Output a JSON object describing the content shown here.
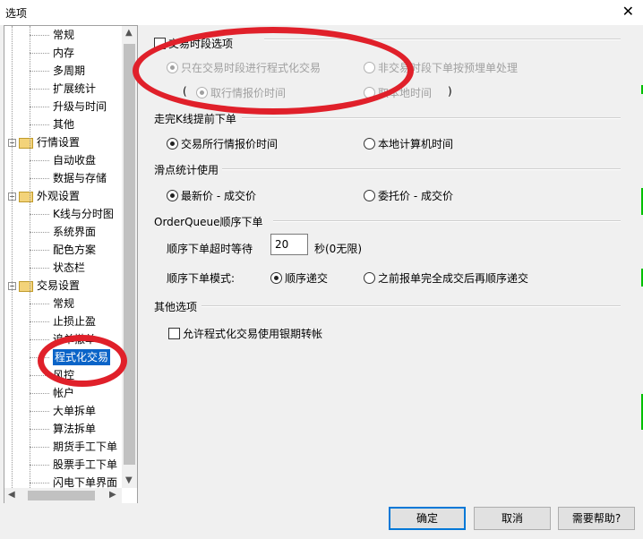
{
  "window": {
    "title": "选项",
    "close_glyph": "✕"
  },
  "tree": {
    "items": [
      {
        "label": "常规"
      },
      {
        "label": "内存"
      },
      {
        "label": "多周期"
      },
      {
        "label": "扩展统计"
      },
      {
        "label": "升级与时间"
      },
      {
        "label": "其他"
      },
      {
        "label": "行情设置",
        "folder": true
      },
      {
        "label": "自动收盘"
      },
      {
        "label": "数据与存储"
      },
      {
        "label": "外观设置",
        "folder": true
      },
      {
        "label": "K线与分时图"
      },
      {
        "label": "系统界面"
      },
      {
        "label": "配色方案"
      },
      {
        "label": "状态栏"
      },
      {
        "label": "交易设置",
        "folder": true
      },
      {
        "label": "常规"
      },
      {
        "label": "止损止盈"
      },
      {
        "label": "追单撤单"
      },
      {
        "label": "程式化交易",
        "selected": true
      },
      {
        "label": "风控"
      },
      {
        "label": "帐户"
      },
      {
        "label": "大单拆单"
      },
      {
        "label": "算法拆单"
      },
      {
        "label": "期货手工下单"
      },
      {
        "label": "股票手工下单"
      },
      {
        "label": "闪电下单界面"
      }
    ]
  },
  "trading_period": {
    "checkbox_label": "交易时段选项",
    "checked": false,
    "opt_only_in_session": "只在交易时段进行程式化交易",
    "opt_non_session": "非交易时段下单按预埋单处理",
    "paren_open": "(",
    "opt_quote_time": "取行情报价时间",
    "opt_local_time": "取本地时间",
    "paren_close": ")"
  },
  "kline_early": {
    "heading": "走完K线提前下单",
    "opt_exchange": "交易所行情报价时间",
    "opt_local": "本地计算机时间",
    "selected": "opt_exchange"
  },
  "slippage": {
    "heading": "滑点统计使用",
    "opt_latest": "最新价 - 成交价",
    "opt_order": "委托价 - 成交价",
    "selected": "opt_latest"
  },
  "order_queue": {
    "heading": "OrderQueue顺序下单",
    "timeout_label": "顺序下单超时等待",
    "timeout_value": "20",
    "timeout_unit": "秒(0无限)",
    "mode_label": "顺序下单模式:",
    "opt_sequential": "顺序递交",
    "opt_after_fill": "之前报单完全成交后再顺序递交",
    "selected": "opt_sequential"
  },
  "other": {
    "heading": "其他选项",
    "allow_transfer": "允许程式化交易使用银期转帐",
    "checked": false
  },
  "buttons": {
    "ok": "确定",
    "cancel": "取消",
    "help": "需要帮助?"
  },
  "colors": {
    "selection": "#0a64c8",
    "annotation": "#e0202a",
    "default_button_border": "#0078d7"
  }
}
